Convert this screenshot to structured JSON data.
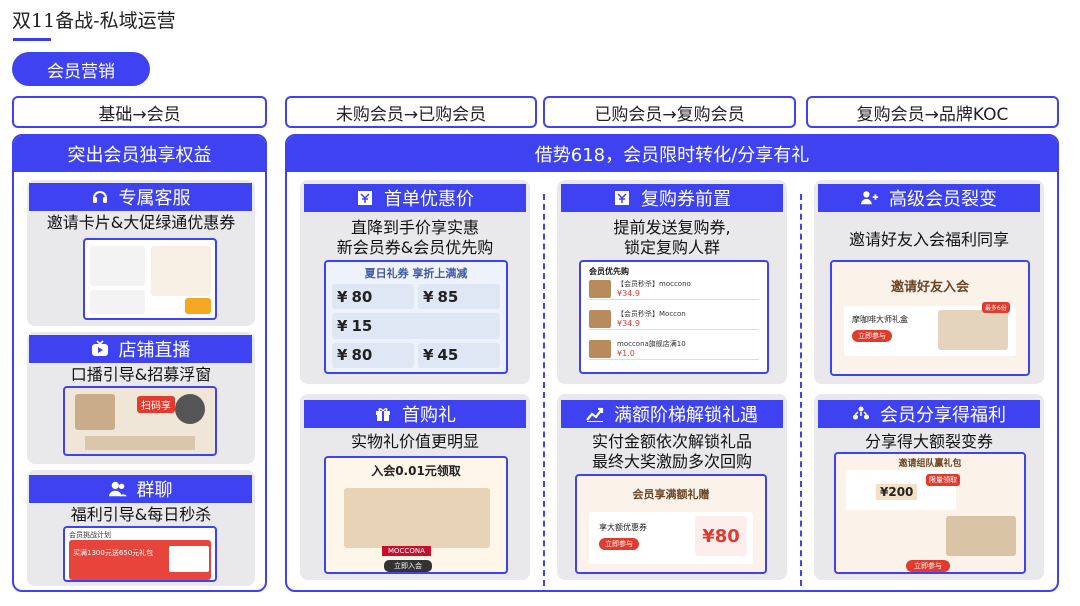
{
  "page_title": "双11备战-私域运营",
  "section_label": "会员营销",
  "stages": [
    "基础→会员",
    "未购会员→已购会员",
    "已购会员→复购会员",
    "复购会员→品牌KOC"
  ],
  "left_column": {
    "header": "突出会员独享权益",
    "cards": [
      {
        "title": "专属客服",
        "icon": "headset-icon",
        "subtitle": "邀请卡片&大促绿通优惠券"
      },
      {
        "title": "店铺直播",
        "icon": "live-tv-icon",
        "subtitle": "口播引导&招募浮窗",
        "shot_badge": "扫码享"
      },
      {
        "title": "群聊",
        "icon": "group-icon",
        "subtitle": "福利引导&每日秒杀",
        "shot_texts": [
          "会员挑战计划",
          "买满1300元送650元礼包"
        ]
      }
    ]
  },
  "right_column": {
    "header": "借势618，会员限时转化/分享有礼",
    "cards": [
      {
        "title": "首单优惠价",
        "icon": "voucher-icon",
        "subtitle_lines": [
          "直降到手价享实惠",
          "新会员券&会员优先购"
        ],
        "shot": {
          "banner": "夏日礼券 享折上满减",
          "coupons": [
            "80",
            "85",
            "15",
            "80",
            "45"
          ]
        }
      },
      {
        "title": "复购券前置",
        "icon": "voucher-icon",
        "subtitle_lines": [
          "提前发送复购券,",
          "锁定复购人群"
        ],
        "shot": {
          "heading": "会员优先购",
          "items": [
            "【会员秒杀】moccono",
            "【会员秒杀】Moccon",
            "moccona旗舰店满10"
          ],
          "prices": [
            "¥34.9",
            "¥34.9",
            "¥1.0"
          ]
        }
      },
      {
        "title": "高级会员裂变",
        "icon": "add-user-icon",
        "subtitle_lines": [
          "邀请好友入会福利同享"
        ],
        "shot": {
          "banner": "邀请好友入会",
          "line": "摩咖啡大师礼盒",
          "button": "立即参与",
          "badge": "最多6份"
        }
      },
      {
        "title": "首购礼",
        "icon": "gift-icon",
        "subtitle_lines": [
          "实物礼价值更明显"
        ],
        "shot": {
          "banner": "入会0.01元领取",
          "brand": "MOCCONA",
          "button": "立即入会"
        }
      },
      {
        "title": "满额阶梯解锁礼遇",
        "icon": "chart-up-icon",
        "subtitle_lines": [
          "实付金额依次解锁礼品",
          "最终大奖激励多次回购"
        ],
        "shot": {
          "banner": "会员享满额礼赠",
          "line": "享大额优惠券",
          "value": "80",
          "button": "立即参与"
        }
      },
      {
        "title": "会员分享得福利",
        "icon": "share-people-icon",
        "subtitle_lines": [
          "分享得大额裂变券"
        ],
        "shot": {
          "banner": "邀请组队赢礼包",
          "value": "¥200",
          "badge": "限量领取",
          "button": "立即参与"
        }
      }
    ]
  },
  "colors": {
    "accent": "#3e42f0",
    "card_bg": "#e9e9ec",
    "price_red": "#e23b2e"
  }
}
